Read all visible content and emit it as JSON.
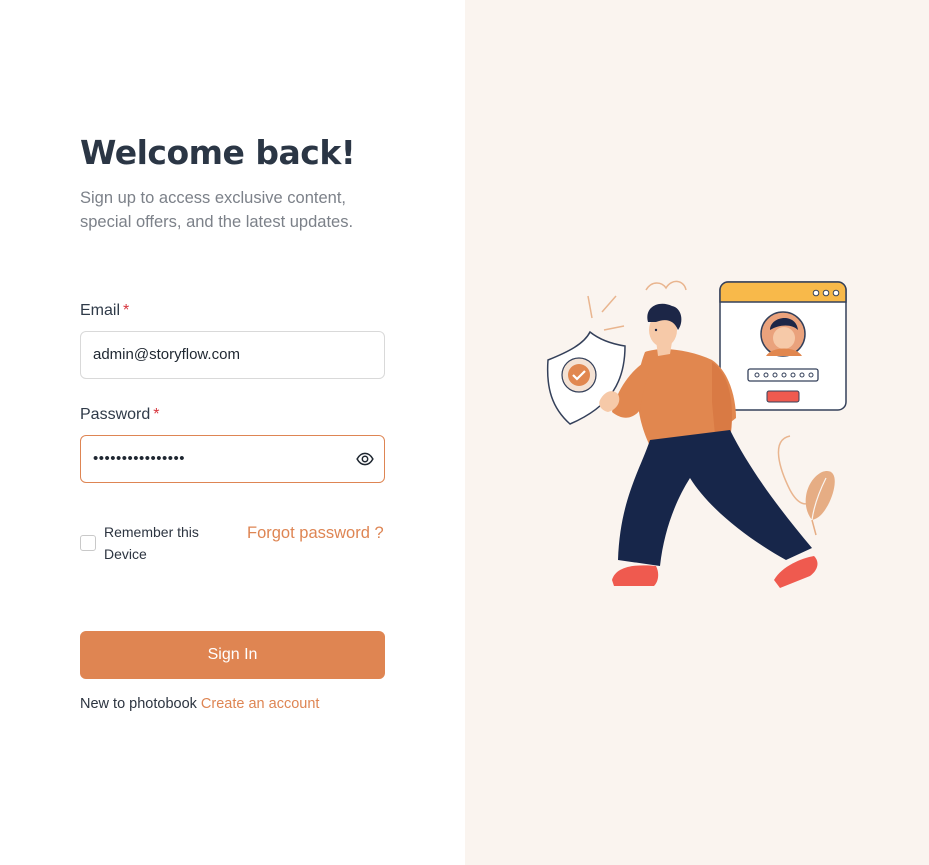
{
  "login": {
    "title": "Welcome back!",
    "subtitle": "Sign up to access exclusive content, special offers, and the latest updates.",
    "email": {
      "label": "Email",
      "required_mark": "*",
      "value": "admin@storyflow.com"
    },
    "password": {
      "label": "Password",
      "required_mark": "*",
      "masked_value": "••••••••••••••••"
    },
    "remember_label": "Remember this Device",
    "forgot_label": "Forgot password ?",
    "signin_label": "Sign In",
    "footer_text": "New to photobook",
    "create_account_label": "Create an account"
  },
  "colors": {
    "accent": "#df8552",
    "title": "#2b3645",
    "panel_bg": "#faf4ef",
    "navy": "#17264a"
  },
  "icons": {
    "password_toggle": "eye-icon",
    "illustration": "security-login-illustration"
  }
}
